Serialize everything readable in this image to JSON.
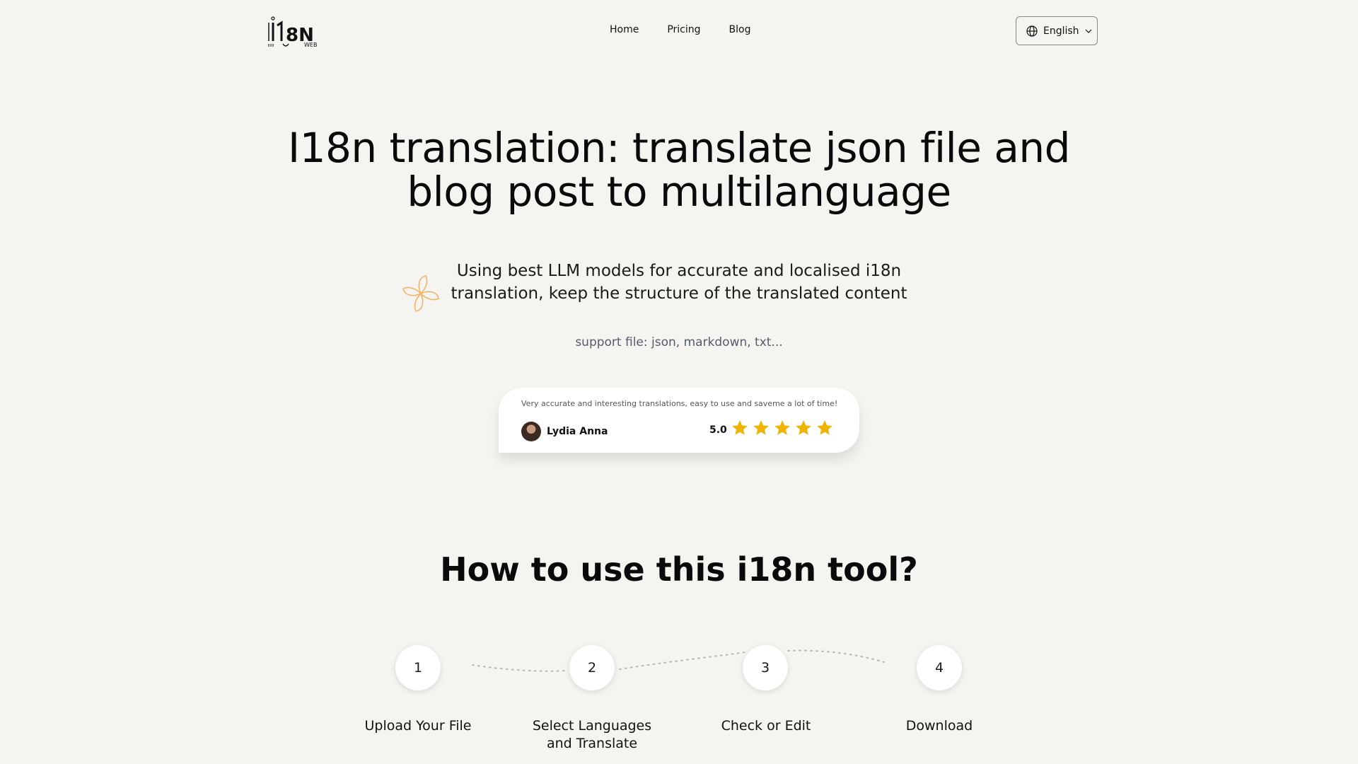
{
  "header": {
    "logo_text": "i18N",
    "logo_sub": "WEB",
    "nav": [
      {
        "label": "Home"
      },
      {
        "label": "Pricing"
      },
      {
        "label": "Blog"
      }
    ],
    "language": {
      "label": "English",
      "icon": "globe-icon"
    }
  },
  "hero": {
    "title_line1": "I18n translation: translate json file and",
    "title_line2": "blog post to multilanguage",
    "subtitle_line1": "Using best LLM models for accurate and localised i18n",
    "subtitle_line2": "translation, keep the structure of the translated content",
    "support": "support file: json, markdown, txt..."
  },
  "review": {
    "text": "Very accurate and interesting translations, easy to use and saveme a lot of time!",
    "name": "Lydia Anna",
    "rating": "5.0",
    "stars": 5,
    "star_color": "#f0b400"
  },
  "how_to": {
    "title": "How to use this i18n tool?",
    "steps": [
      {
        "number": "1",
        "label": "Upload Your File"
      },
      {
        "number": "2",
        "label": "Select Languages and Translate"
      },
      {
        "number": "3",
        "label": "Check or Edit"
      },
      {
        "number": "4",
        "label": "Download"
      }
    ]
  },
  "colors": {
    "background": "#f5f4f0",
    "sparkle": "#f3b46a"
  }
}
